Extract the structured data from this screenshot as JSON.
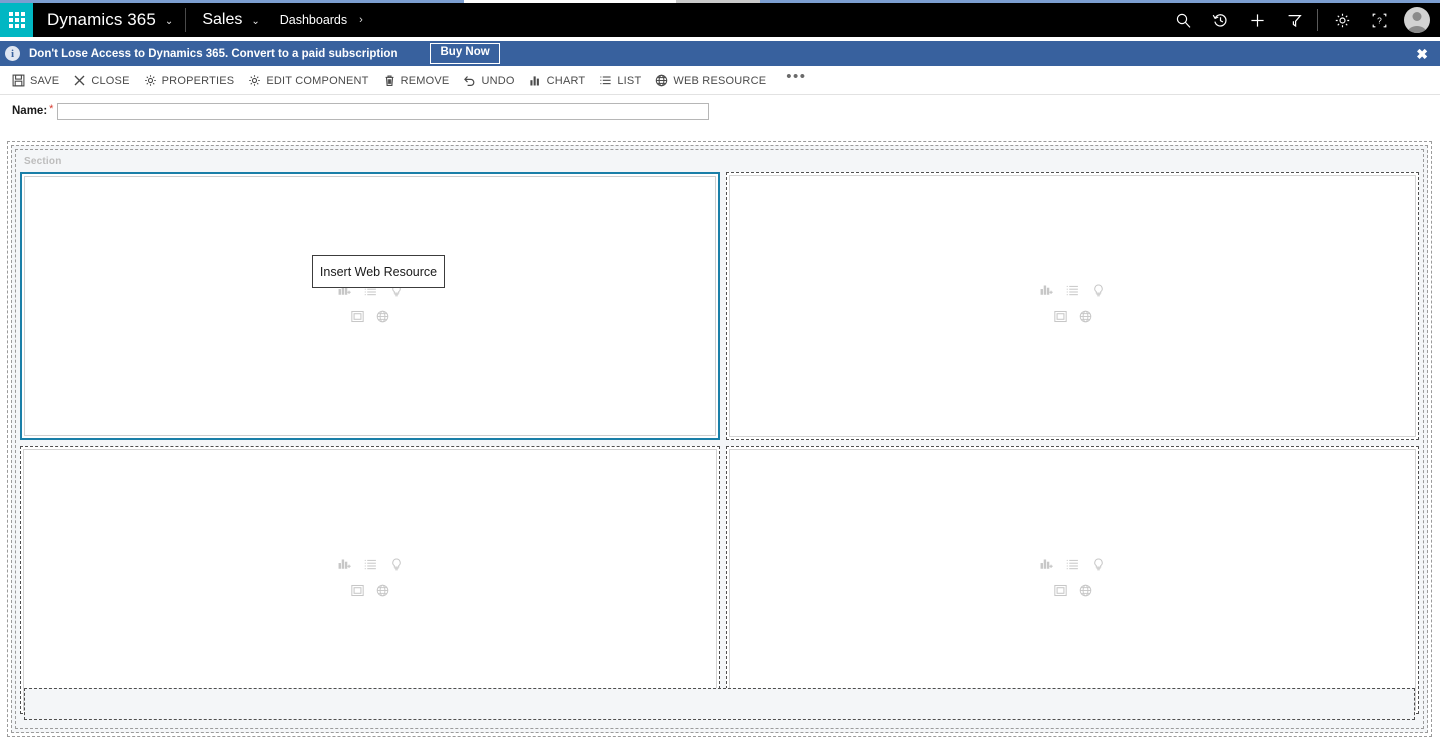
{
  "browser": {
    "strip_color": "#7c9ed0"
  },
  "topnav": {
    "waffle_icon": "app-launcher-waffle-icon",
    "product_title": "Dynamics 365",
    "product_chevron": "⌄",
    "app_name": "Sales",
    "app_chevron": "⌄",
    "breadcrumb": "Dashboards",
    "breadcrumb_arrow": "›",
    "background_color": "#000000",
    "waffle_color": "#00b7c3",
    "icons": [
      {
        "name": "search-icon",
        "title": "Search"
      },
      {
        "name": "recent-history-icon",
        "title": "Recently Viewed"
      },
      {
        "name": "add-new-icon",
        "title": "Quick Create"
      },
      {
        "name": "filter-icon",
        "title": "Filter"
      },
      {
        "name": "gear-settings-icon",
        "title": "Settings"
      },
      {
        "name": "help-icon",
        "title": "Help"
      }
    ],
    "avatar": "user-avatar"
  },
  "notification": {
    "info_glyph": "i",
    "message": "Don't Lose Access to Dynamics 365. Convert to a paid subscription",
    "buy_button": "Buy Now",
    "close_glyph": "✖",
    "background_color": "#38619e"
  },
  "commandbar": {
    "items": [
      {
        "label": "SAVE",
        "icon": "save-disk-icon"
      },
      {
        "label": "CLOSE",
        "icon": "close-x-icon"
      },
      {
        "label": "PROPERTIES",
        "icon": "gear-properties-icon"
      },
      {
        "label": "EDIT COMPONENT",
        "icon": "gear-edit-component-icon"
      },
      {
        "label": "REMOVE",
        "icon": "trash-remove-icon"
      },
      {
        "label": "UNDO",
        "icon": "undo-arrow-icon"
      },
      {
        "label": "CHART",
        "icon": "bar-chart-icon"
      },
      {
        "label": "LIST",
        "icon": "list-icon"
      },
      {
        "label": "WEB RESOURCE",
        "icon": "globe-web-resource-icon"
      }
    ],
    "overflow": "•••"
  },
  "form": {
    "name_label": "Name:",
    "required_marker": "*",
    "name_value": "",
    "name_placeholder": ""
  },
  "designer": {
    "section_label": "Section",
    "cells": [
      {
        "id": "cell-1",
        "selected": true,
        "position": "top-left"
      },
      {
        "id": "cell-2",
        "selected": false,
        "position": "top-right"
      },
      {
        "id": "cell-3",
        "selected": false,
        "position": "bottom-left"
      },
      {
        "id": "cell-4",
        "selected": false,
        "position": "bottom-right"
      }
    ],
    "cell_insert_icons": [
      {
        "name": "insert-chart-icon",
        "title": "Insert Chart"
      },
      {
        "name": "insert-list-icon",
        "title": "Insert List"
      },
      {
        "name": "insert-assistant-icon",
        "title": "Insert Assistant"
      },
      {
        "name": "insert-iframe-icon",
        "title": "Insert IFRAME"
      },
      {
        "name": "insert-web-resource-icon",
        "title": "Insert Web Resource"
      }
    ],
    "selected_border_color": "#1a7fa8"
  },
  "tooltip": {
    "text": "Insert Web Resource",
    "visible": true
  }
}
